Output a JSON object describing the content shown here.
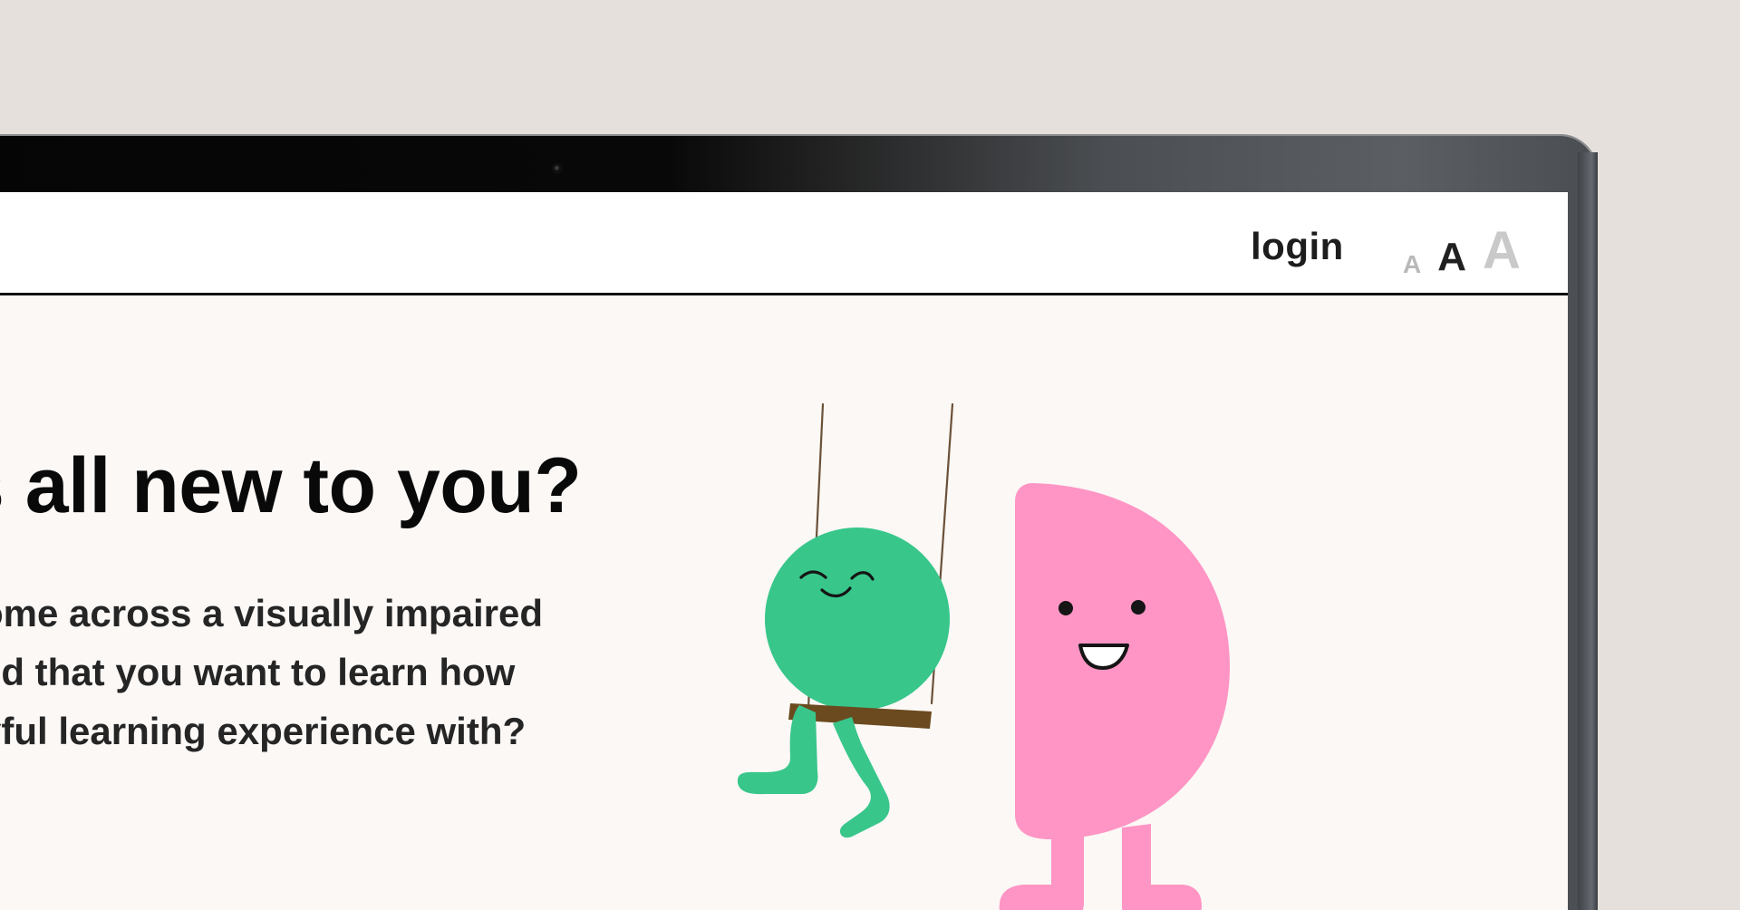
{
  "header": {
    "login_label": "login",
    "font_size_options": [
      "A",
      "A",
      "A"
    ]
  },
  "hero": {
    "heading": "s all new to you?",
    "paragraph_lines": [
      "ome across a visually impaired",
      "ild that you want to learn how",
      "yful learning experience with?"
    ]
  },
  "illustration": {
    "left_character_color": "#38c68b",
    "right_character_color": "#ff95c4",
    "swing_color": "#6b4a1f"
  },
  "colors": {
    "background": "#e5e0dc",
    "screen_background": "#fbf8f6",
    "header_background": "#ffffff",
    "text_primary": "#090909"
  }
}
